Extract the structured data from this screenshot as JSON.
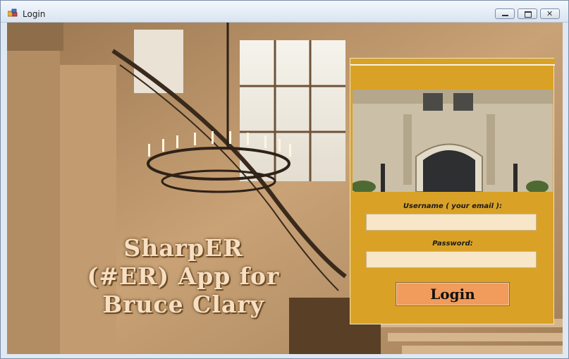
{
  "window": {
    "title": "Login",
    "controls": {
      "minimize": "minimize",
      "maximize": "maximize",
      "close": "close"
    }
  },
  "headline": {
    "lines": [
      "SharpER",
      "(#ER) App for",
      "Bruce Clary"
    ]
  },
  "login": {
    "username_label": "Username ( your email ):",
    "username_value": "",
    "password_label": "Password:",
    "password_value": "",
    "button_label": "Login"
  },
  "colors": {
    "panel": "#d9a227",
    "field": "#f8e6c9",
    "button": "#f19b5c",
    "headline": "#f6dfc2"
  },
  "icons": [
    "app-icon",
    "minimize-icon",
    "maximize-icon",
    "close-icon"
  ]
}
